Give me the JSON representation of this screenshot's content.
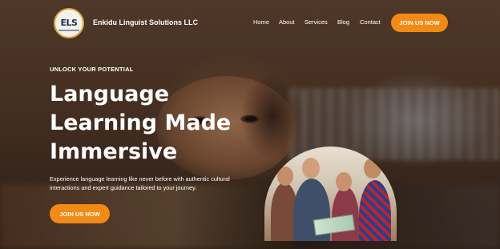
{
  "header": {
    "logo_text": "ELS",
    "brand_name": "Enkidu Linguist Solutions LLC",
    "nav": [
      "Home",
      "About",
      "Services",
      "Blog",
      "Contact"
    ],
    "cta_label": "JOIN US NOW"
  },
  "hero": {
    "eyebrow": "UNLOCK YOUR POTENTIAL",
    "headline_lines": [
      "Language",
      "Learning Made",
      "Immersive"
    ],
    "description": "Experience language learning like never before with authentic cultural interactions and expert guidance tailored to your journey.",
    "cta_label": "JOIN US NOW"
  },
  "colors": {
    "accent": "#f28a16",
    "text": "#ffffff",
    "logo_navy": "#1e2e5e",
    "logo_gold": "#d9a53a"
  }
}
